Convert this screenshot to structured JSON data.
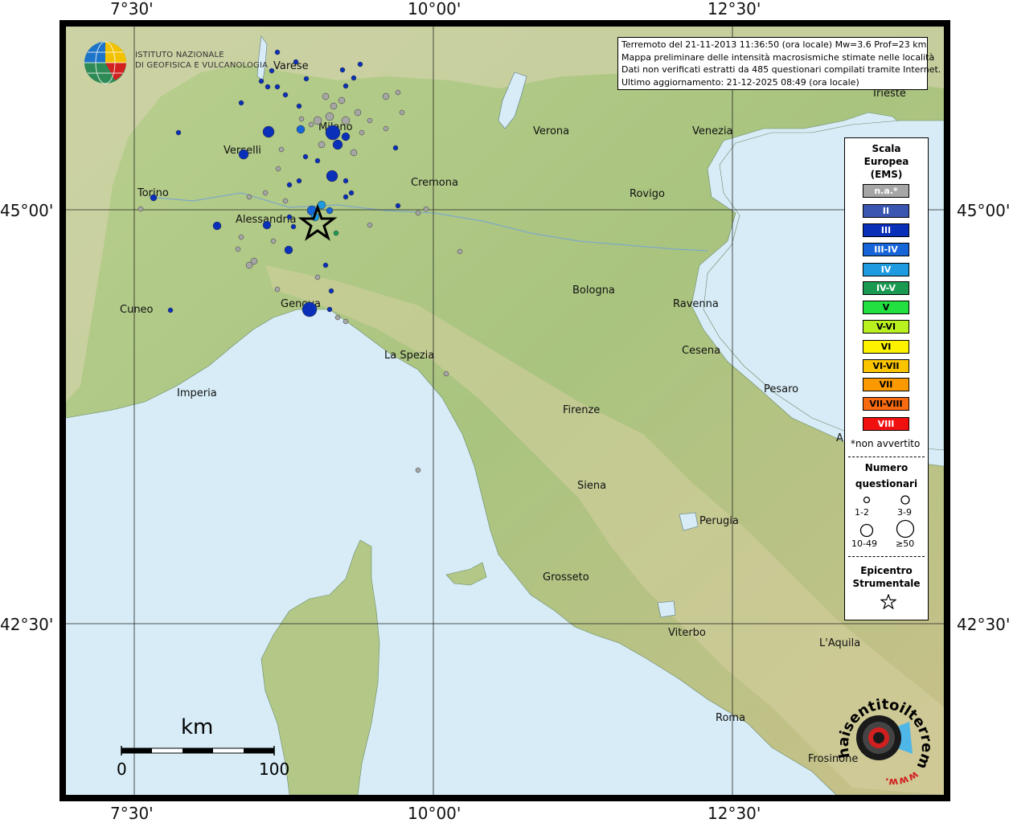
{
  "coords": {
    "top": [
      "7°30'",
      "10°00'",
      "12°30'"
    ],
    "bottom": [
      "7°30'",
      "10°00'",
      "12°30'"
    ],
    "left": [
      "45°00'",
      "42°30'"
    ],
    "right": [
      "45°00'",
      "42°30'"
    ]
  },
  "logo": {
    "line1": "ISTITUTO NAZIONALE",
    "line2": "DI GEOFISICA E VULCANOLOGIA"
  },
  "info": {
    "line1": "Terremoto del 21-11-2013 11:36:50 (ora locale) Mw=3.6 Prof=23 km",
    "line2": "Mappa preliminare delle intensità macrosismiche stimate nelle località",
    "line3": "Dati non verificati estratti da 485 questionari compilati tramite Internet.",
    "line4": "Ultimo aggiornamento: 21-12-2025 08:49 (ora locale)"
  },
  "cities": [
    {
      "name": "Varese"
    },
    {
      "name": "Milano"
    },
    {
      "name": "Vercelli"
    },
    {
      "name": "Torino"
    },
    {
      "name": "Alessandria"
    },
    {
      "name": "Cremona"
    },
    {
      "name": "Verona"
    },
    {
      "name": "Venezia"
    },
    {
      "name": "Trieste"
    },
    {
      "name": "Rovigo"
    },
    {
      "name": "Cuneo"
    },
    {
      "name": "Genova"
    },
    {
      "name": "Bologna"
    },
    {
      "name": "Ravenna"
    },
    {
      "name": "Cesena"
    },
    {
      "name": "La Spezia"
    },
    {
      "name": "Imperia"
    },
    {
      "name": "Pesaro"
    },
    {
      "name": "Firenze"
    },
    {
      "name": "Siena"
    },
    {
      "name": "Perugia"
    },
    {
      "name": "Grosseto"
    },
    {
      "name": "Viterbo"
    },
    {
      "name": "L'Aquila"
    },
    {
      "name": "Roma"
    },
    {
      "name": "Frosinone"
    },
    {
      "name": "A"
    }
  ],
  "legend": {
    "title1": "Scala",
    "title2": "Europea",
    "title3": "(EMS)",
    "classes": [
      {
        "label": "n.a.*",
        "color": "#a6a6a6"
      },
      {
        "label": "II",
        "color": "#3a56b0"
      },
      {
        "label": "III",
        "color": "#0a2fb8"
      },
      {
        "label": "III-IV",
        "color": "#1565d8"
      },
      {
        "label": "IV",
        "color": "#1e9be0"
      },
      {
        "label": "IV-V",
        "color": "#1a9a50"
      },
      {
        "label": "V",
        "color": "#22e040"
      },
      {
        "label": "V-VI",
        "color": "#b8f020"
      },
      {
        "label": "VI",
        "color": "#fdf200"
      },
      {
        "label": "VI-VII",
        "color": "#fbc400"
      },
      {
        "label": "VII",
        "color": "#fb9a00"
      },
      {
        "label": "VII-VIII",
        "color": "#f86a10"
      },
      {
        "label": "VIII",
        "color": "#f01010"
      }
    ],
    "note": "*non avvertito",
    "count_title1": "Numero",
    "count_title2": "questionari",
    "sizes": [
      "1-2",
      "3-9",
      "10-49",
      "≥50"
    ],
    "epi_title1": "Epicentro",
    "epi_title2": "Strumentale"
  },
  "scale": {
    "unit": "km",
    "start": "0",
    "end": "100"
  },
  "brand": {
    "text": "haisentitoilterremoto.it",
    "www": "www."
  }
}
